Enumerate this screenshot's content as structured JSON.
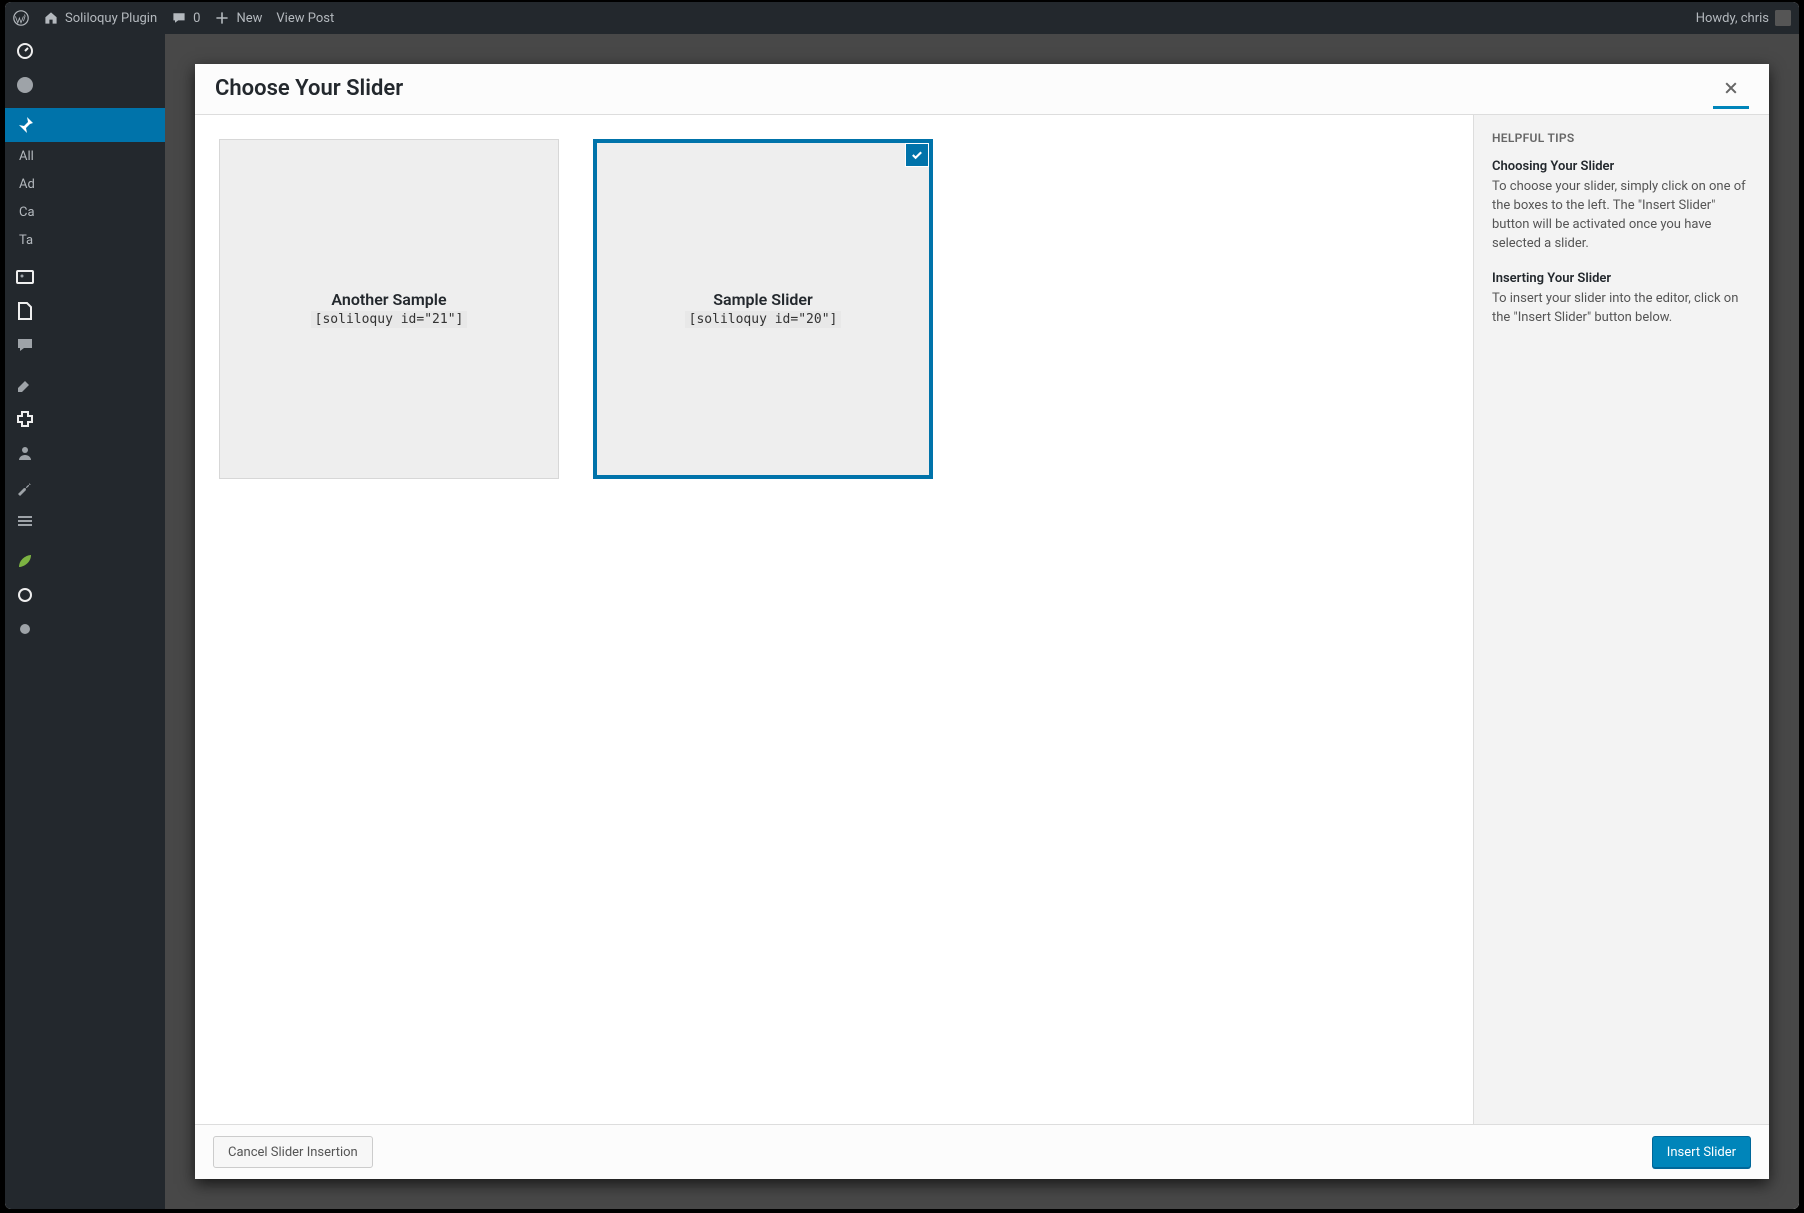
{
  "adminbar": {
    "site_name": "Soliloquy Plugin",
    "comments_count": "0",
    "new_label": "New",
    "view_post_label": "View Post",
    "howdy": "Howdy, chris"
  },
  "sidebar": {
    "submenu": {
      "all_posts": "All",
      "add_new": "Ad",
      "categories": "Ca",
      "tags": "Ta"
    }
  },
  "modal": {
    "title": "Choose Your Slider"
  },
  "sliders": [
    {
      "title": "Another Sample",
      "shortcode": "[soliloquy id=\"21\"]",
      "selected": false
    },
    {
      "title": "Sample Slider",
      "shortcode": "[soliloquy id=\"20\"]",
      "selected": true
    }
  ],
  "tips": {
    "heading": "HELPFUL TIPS",
    "choosing_title": "Choosing Your Slider",
    "choosing_text": "To choose your slider, simply click on one of the boxes to the left. The \"Insert Slider\" button will be activated once you have selected a slider.",
    "inserting_title": "Inserting Your Slider",
    "inserting_text": "To insert your slider into the editor, click on the \"Insert Slider\" button below."
  },
  "footer": {
    "cancel": "Cancel Slider Insertion",
    "insert": "Insert Slider"
  }
}
